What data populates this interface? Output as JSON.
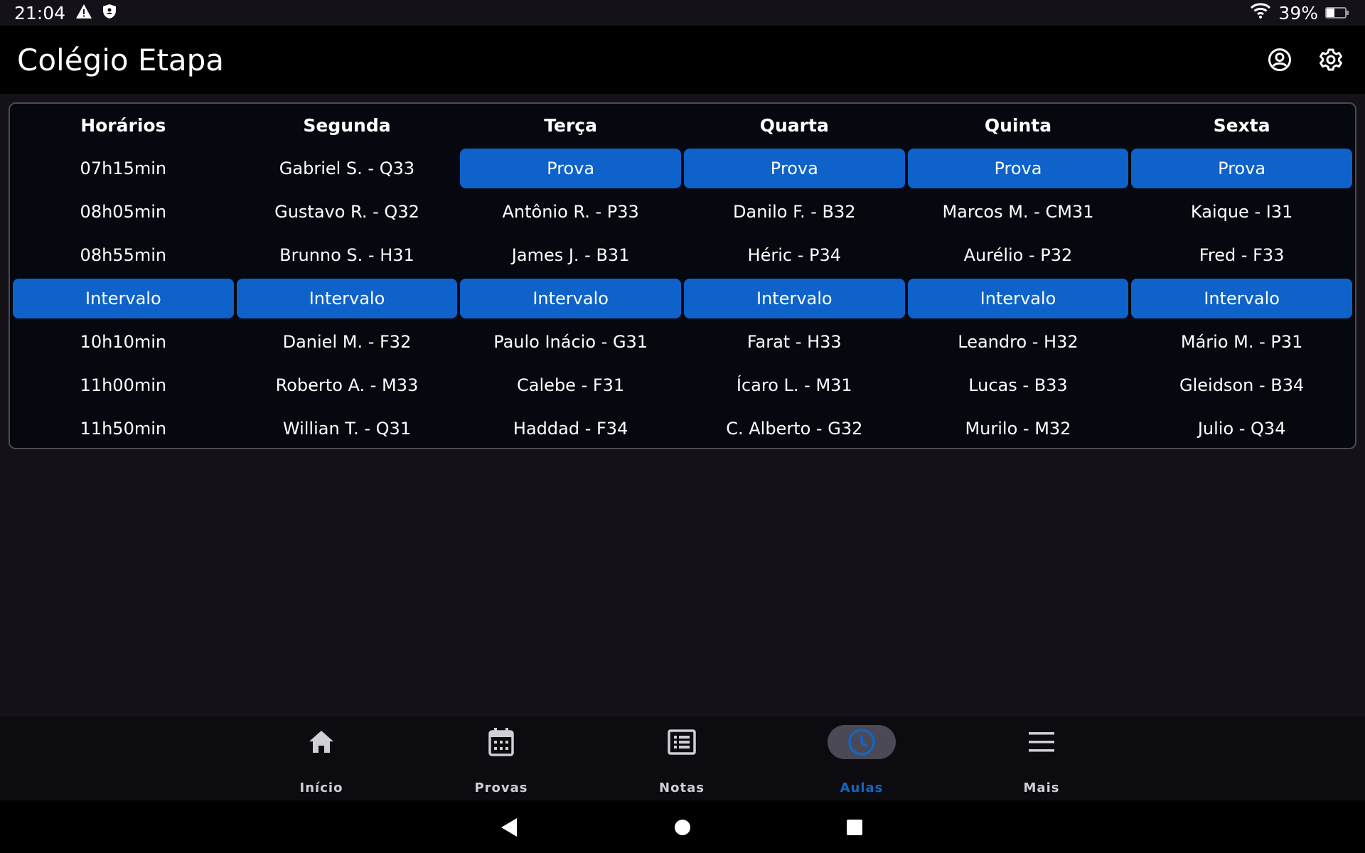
{
  "status_bar": {
    "time": "21:04",
    "battery_text": "39%",
    "icons": [
      "alert-icon",
      "shield-icon",
      "wifi-icon",
      "battery-icon"
    ]
  },
  "app_bar": {
    "title": "Colégio Etapa",
    "actions": [
      "account-icon",
      "gear-icon"
    ]
  },
  "schedule": {
    "headers": [
      "Horários",
      "Segunda",
      "Terça",
      "Quarta",
      "Quinta",
      "Sexta"
    ],
    "rows": [
      {
        "cells": [
          {
            "text": "07h15min",
            "hl": false
          },
          {
            "text": "Gabriel S. - Q33",
            "hl": false
          },
          {
            "text": "Prova",
            "hl": true
          },
          {
            "text": "Prova",
            "hl": true
          },
          {
            "text": "Prova",
            "hl": true
          },
          {
            "text": "Prova",
            "hl": true
          }
        ]
      },
      {
        "cells": [
          {
            "text": "08h05min",
            "hl": false
          },
          {
            "text": "Gustavo R. - Q32",
            "hl": false
          },
          {
            "text": "Antônio R. - P33",
            "hl": false
          },
          {
            "text": "Danilo F. - B32",
            "hl": false
          },
          {
            "text": "Marcos M. - CM31",
            "hl": false
          },
          {
            "text": "Kaique - I31",
            "hl": false
          }
        ]
      },
      {
        "cells": [
          {
            "text": "08h55min",
            "hl": false
          },
          {
            "text": "Brunno S. - H31",
            "hl": false
          },
          {
            "text": "James J. - B31",
            "hl": false
          },
          {
            "text": "Héric - P34",
            "hl": false
          },
          {
            "text": "Aurélio - P32",
            "hl": false
          },
          {
            "text": "Fred - F33",
            "hl": false
          }
        ]
      },
      {
        "cells": [
          {
            "text": "Intervalo",
            "hl": true
          },
          {
            "text": "Intervalo",
            "hl": true
          },
          {
            "text": "Intervalo",
            "hl": true
          },
          {
            "text": "Intervalo",
            "hl": true
          },
          {
            "text": "Intervalo",
            "hl": true
          },
          {
            "text": "Intervalo",
            "hl": true
          }
        ]
      },
      {
        "cells": [
          {
            "text": "10h10min",
            "hl": false
          },
          {
            "text": "Daniel M. - F32",
            "hl": false
          },
          {
            "text": "Paulo Inácio - G31",
            "hl": false
          },
          {
            "text": "Farat - H33",
            "hl": false
          },
          {
            "text": "Leandro - H32",
            "hl": false
          },
          {
            "text": "Mário M. - P31",
            "hl": false
          }
        ]
      },
      {
        "cells": [
          {
            "text": "11h00min",
            "hl": false
          },
          {
            "text": "Roberto A. - M33",
            "hl": false
          },
          {
            "text": "Calebe - F31",
            "hl": false
          },
          {
            "text": "Ícaro L. - M31",
            "hl": false
          },
          {
            "text": "Lucas - B33",
            "hl": false
          },
          {
            "text": "Gleidson - B34",
            "hl": false
          }
        ]
      },
      {
        "cells": [
          {
            "text": "11h50min",
            "hl": false
          },
          {
            "text": "Willian T. - Q31",
            "hl": false
          },
          {
            "text": "Haddad - F34",
            "hl": false
          },
          {
            "text": "C. Alberto - G32",
            "hl": false
          },
          {
            "text": "Murilo - M32",
            "hl": false
          },
          {
            "text": "Julio - Q34",
            "hl": false
          }
        ]
      }
    ],
    "highlight_color": "#0e62c9"
  },
  "bottom_nav": {
    "items": [
      {
        "label": "Início",
        "icon": "home-icon",
        "active": false
      },
      {
        "label": "Provas",
        "icon": "calendar-icon",
        "active": false
      },
      {
        "label": "Notas",
        "icon": "list-icon",
        "active": false
      },
      {
        "label": "Aulas",
        "icon": "clock-icon",
        "active": true
      },
      {
        "label": "Mais",
        "icon": "menu-icon",
        "active": false
      }
    ],
    "active_color": "#1565c0"
  },
  "system_nav": {
    "buttons": [
      "back-icon",
      "home-circle-icon",
      "recents-icon"
    ]
  }
}
